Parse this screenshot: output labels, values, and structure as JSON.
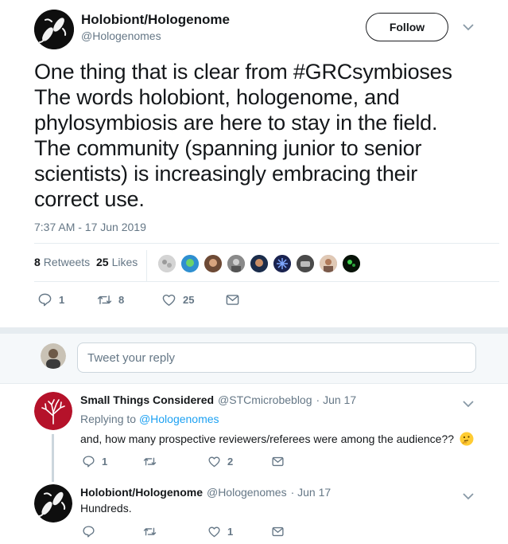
{
  "main_tweet": {
    "display_name": "Holobiont/Hologenome",
    "handle": "@Hologenomes",
    "follow_label": "Follow",
    "text_lines": [
      "One thing that is clear from #GRCsymbioses",
      "The words holobiont, hologenome, and",
      "phylosymbiosis are here to stay in the field.",
      "The community (spanning junior to senior",
      "scientists) is increasingly embracing their",
      "correct use."
    ],
    "timestamp": "7:37 AM - 17 Jun 2019",
    "retweets_count": "8",
    "retweets_label": "Retweets",
    "likes_count": "25",
    "likes_label": "Likes",
    "actions": {
      "reply_count": "1",
      "retweet_count": "8",
      "like_count": "25"
    }
  },
  "reply_composer": {
    "placeholder": "Tweet your reply"
  },
  "replies": [
    {
      "display_name": "Small Things Considered",
      "handle": "@STCmicrobeblog",
      "date": "· Jun 17",
      "replying_prefix": "Replying to",
      "replying_handle": "@Hologenomes",
      "text": "and, how many prospective reviewers/referees were among the audience??",
      "emoji": "🤔",
      "reply_count": "1",
      "retweet_count": "",
      "like_count": "2"
    },
    {
      "display_name": "Holobiont/Hologenome",
      "handle": "@Hologenomes",
      "date": "· Jun 17",
      "text": "Hundreds.",
      "reply_count": "",
      "retweet_count": "",
      "like_count": "1"
    }
  ],
  "icons": {
    "reply": "reply-icon",
    "retweet": "retweet-icon",
    "like": "heart-icon",
    "message": "envelope-icon",
    "menu": "chevron-down-icon"
  },
  "colors": {
    "accent": "#1da1f2",
    "text": "#14171a",
    "muted": "#657786",
    "divider": "#e6ecf0"
  }
}
